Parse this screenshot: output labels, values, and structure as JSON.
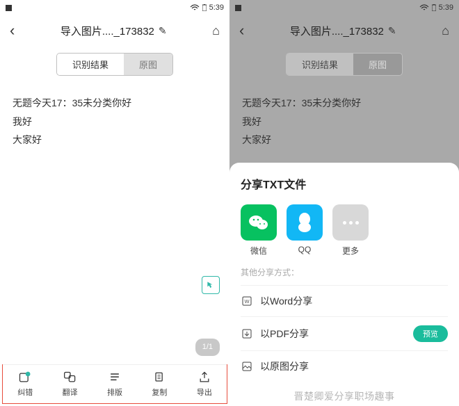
{
  "status": {
    "time": "5:39"
  },
  "header": {
    "title": "导入图片...._173832"
  },
  "tabs": {
    "result": "识别结果",
    "original": "原图"
  },
  "content": {
    "line1": "无题今天17：35未分类你好",
    "line2": "我好",
    "line3": "大家好"
  },
  "page": {
    "indicator": "1/1"
  },
  "toolbar": {
    "correct": "纠错",
    "translate": "翻译",
    "layout": "排版",
    "copy": "复制",
    "export": "导出"
  },
  "sheet": {
    "title": "分享TXT文件",
    "wechat": "微信",
    "qq": "QQ",
    "more": "更多",
    "other_label": "其他分享方式：",
    "word": "以Word分享",
    "pdf": "以PDF分享",
    "image": "以原图分享",
    "preview": "预览"
  },
  "watermark": "晋楚卿爱分享职场趣事"
}
